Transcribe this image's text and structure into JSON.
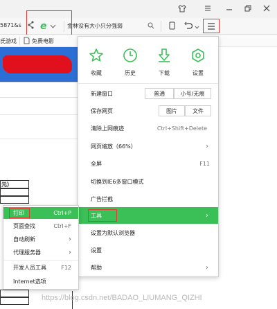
{
  "address": {
    "url_fragment": "5871&s",
    "search_text": "金林没有大小只分强弱"
  },
  "bookmarks": {
    "item1": "氏游戏",
    "item2": "免费电影"
  },
  "menu": {
    "top_icons": [
      {
        "label": "收藏"
      },
      {
        "label": "历史"
      },
      {
        "label": "下载"
      },
      {
        "label": "设置"
      }
    ],
    "new_window_label": "新建窗口",
    "new_window_normal": "普通",
    "new_window_incognito": "小号/无痕",
    "save_page_label": "保存网页",
    "save_page_image": "图片",
    "save_page_file": "文件",
    "clear_data_label": "清除上网痕迹",
    "clear_data_shortcut": "Ctrl+Shift+Delete",
    "zoom_label": "网页缩放（66%）",
    "fullscreen_label": "全屏",
    "fullscreen_shortcut": "F11",
    "ie6_label": "切换到IE6多窗口模式",
    "adblock_label": "广告拦截",
    "tools_label": "工具",
    "default_browser_label": "设置为默认浏览器",
    "settings_label": "设置",
    "help_label": "帮助"
  },
  "submenu": {
    "print_label": "打印",
    "print_shortcut": "Ctrl+P",
    "find_label": "页面查找",
    "find_shortcut": "Ctrl+F",
    "autorefresh_label": "自动刷新",
    "proxy_label": "代理服务器",
    "devtools_label": "开发人员工具",
    "devtools_shortcut": "F12",
    "internet_options_label": "Internet选项"
  },
  "page": {
    "table_header_fragment": "元）"
  },
  "watermark": "https://blog.csdn.net/BADAO_LIUMANG_QIZHI",
  "colors": {
    "accent_green": "#3bbf57",
    "highlight_red": "#e53935"
  }
}
